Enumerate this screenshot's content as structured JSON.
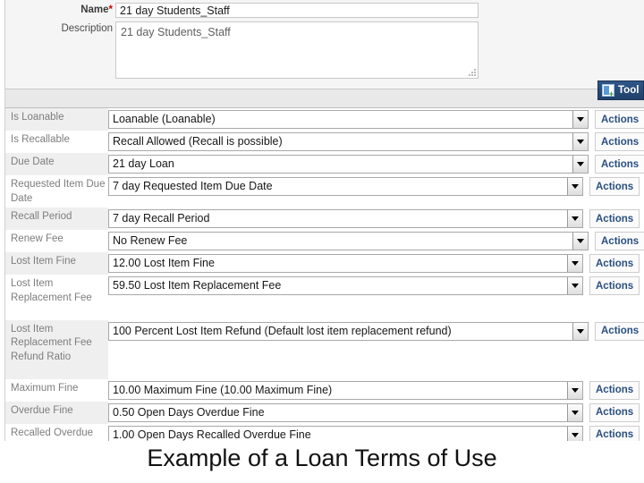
{
  "header": {
    "name_label": "Name",
    "required_marker": "*",
    "name_value": "21 day Students_Staff",
    "description_label": "Description",
    "description_value": "21 day Students_Staff",
    "description_placeholder": "Description"
  },
  "toolbox": {
    "label": "Tool",
    "icon": "toolbox-icon",
    "background_color": "#2f5788"
  },
  "colors": {
    "label_gray": "#7d7d7d",
    "row_shade": "#efefef",
    "actions_blue": "#2a4f80",
    "required_red": "#cc0000",
    "select_border": "#a8a8a8"
  },
  "actions_label": "Actions",
  "rows": [
    {
      "label": "Is Loanable",
      "value": "Loanable (Loanable)",
      "shade": true,
      "label_lines": 1,
      "field_width": 537
    },
    {
      "label": "Is Recallable",
      "value": "Recall Allowed (Recall is possible)",
      "shade": false,
      "label_lines": 1,
      "field_width": 537
    },
    {
      "label": "Due Date",
      "value": "21 day Loan",
      "shade": true,
      "label_lines": 1,
      "field_width": 537
    },
    {
      "label": "Requested Item Due Date",
      "value": "7 day Requested Item Due Date",
      "shade": false,
      "label_lines": 2,
      "field_width": 531
    },
    {
      "label": "Recall Period",
      "value": "7 day Recall Period",
      "shade": true,
      "label_lines": 1,
      "field_width": 531
    },
    {
      "label": "Renew Fee",
      "value": "No Renew Fee",
      "shade": false,
      "label_lines": 1,
      "field_width": 537
    },
    {
      "label": "Lost Item Fine",
      "value": "12.00 Lost Item Fine",
      "shade": true,
      "label_lines": 1,
      "field_width": 531
    },
    {
      "label": "Lost Item Replacement Fee",
      "value": "59.50 Lost Item Replacement Fee",
      "shade": false,
      "label_lines": 3,
      "field_width": 531
    },
    {
      "label": "Lost Item Replacement Fee Refund Ratio",
      "value": "100 Percent Lost Item Refund (Default lost item replacement refund)",
      "shade": true,
      "label_lines": 4,
      "field_width": 537
    },
    {
      "label": "Maximum Fine",
      "value": "10.00 Maximum Fine (10.00 Maximum Fine)",
      "shade": false,
      "label_lines": 1,
      "field_width": 531
    },
    {
      "label": "Overdue Fine",
      "value": "0.50 Open Days Overdue Fine",
      "shade": true,
      "label_lines": 1,
      "field_width": 531
    },
    {
      "label": "Recalled Overdue Fine",
      "value": "1.00 Open Days Recalled Overdue Fine",
      "shade": false,
      "label_lines": 2,
      "field_width": 531
    }
  ],
  "caption": "Example of a Loan Terms of Use"
}
